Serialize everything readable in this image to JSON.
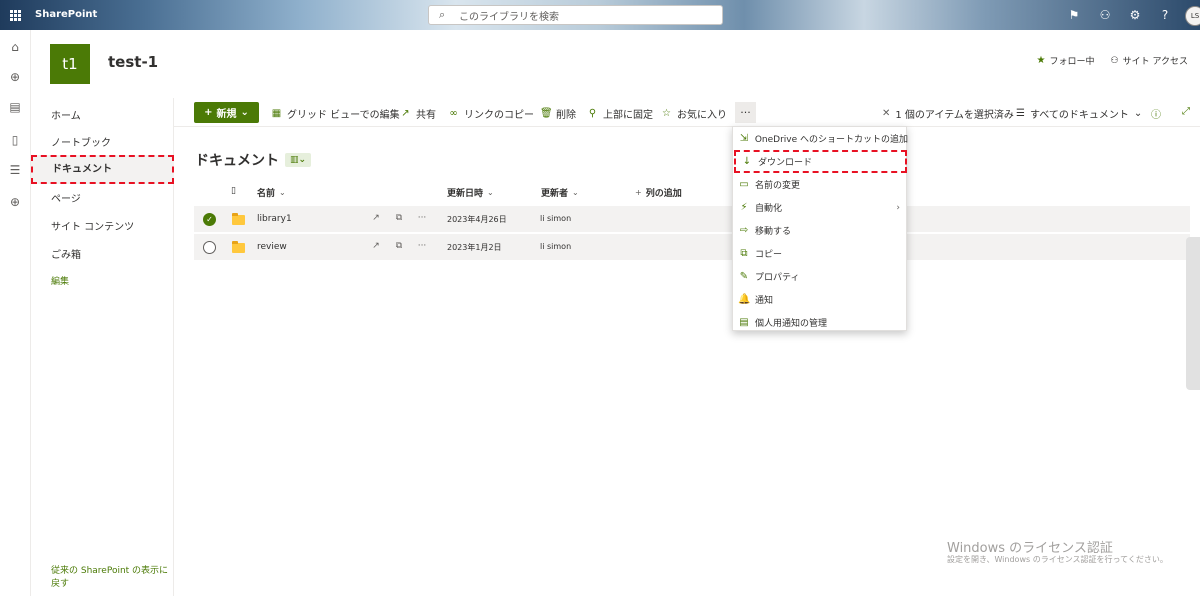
{
  "suitebar": {
    "app_name": "SharePoint",
    "search_placeholder": "このライブラリを検索",
    "avatar_initials": "LS"
  },
  "site": {
    "logo_initials": "t1",
    "title": "test-1",
    "follow_label": "フォロー中",
    "site_access_label": "サイト アクセス"
  },
  "nav": {
    "items": [
      "ホーム",
      "ノートブック",
      "ドキュメント",
      "ページ",
      "サイト コンテンツ",
      "ごみ箱"
    ],
    "edit_label": "編集",
    "footer_link": "従来の SharePoint の表示に戻す"
  },
  "commands": {
    "new_label": "新規",
    "grid_edit": "グリッド ビューでの編集",
    "share": "共有",
    "copy_link": "リンクのコピー",
    "delete": "削除",
    "pin_top": "上部に固定",
    "favorite": "お気に入り",
    "more": "···",
    "selected_count": "1 個のアイテムを選択済み",
    "view_label": "すべてのドキュメント"
  },
  "library": {
    "title": "ドキュメント",
    "columns": {
      "name": "名前",
      "modified": "更新日時",
      "modified_by": "更新者",
      "add_column": "列の追加"
    },
    "rows": [
      {
        "name": "library1",
        "modified": "2023年4月26日",
        "modified_by": "li simon",
        "selected": true
      },
      {
        "name": "review",
        "modified": "2023年1月2日",
        "modified_by": "li simon",
        "selected": false
      }
    ]
  },
  "context_menu": {
    "items": [
      {
        "label": "OneDrive へのショートカットの追加",
        "icon": "shortcut-icon"
      },
      {
        "label": "ダウンロード",
        "icon": "download-icon"
      },
      {
        "label": "名前の変更",
        "icon": "rename-icon"
      },
      {
        "label": "自動化",
        "icon": "automate-icon",
        "submenu": true
      },
      {
        "label": "移動する",
        "icon": "move-icon"
      },
      {
        "label": "コピー",
        "icon": "copy-icon"
      },
      {
        "label": "プロパティ",
        "icon": "properties-icon"
      },
      {
        "label": "通知",
        "icon": "bell-icon"
      },
      {
        "label": "個人用通知の管理",
        "icon": "manage-alerts-icon"
      }
    ]
  },
  "watermark": {
    "line1": "Windows のライセンス認証",
    "line2": "設定を開き、Windows のライセンス認証を行ってください。"
  },
  "colors": {
    "accent": "#4b7a06",
    "highlight_border": "#e81123"
  }
}
